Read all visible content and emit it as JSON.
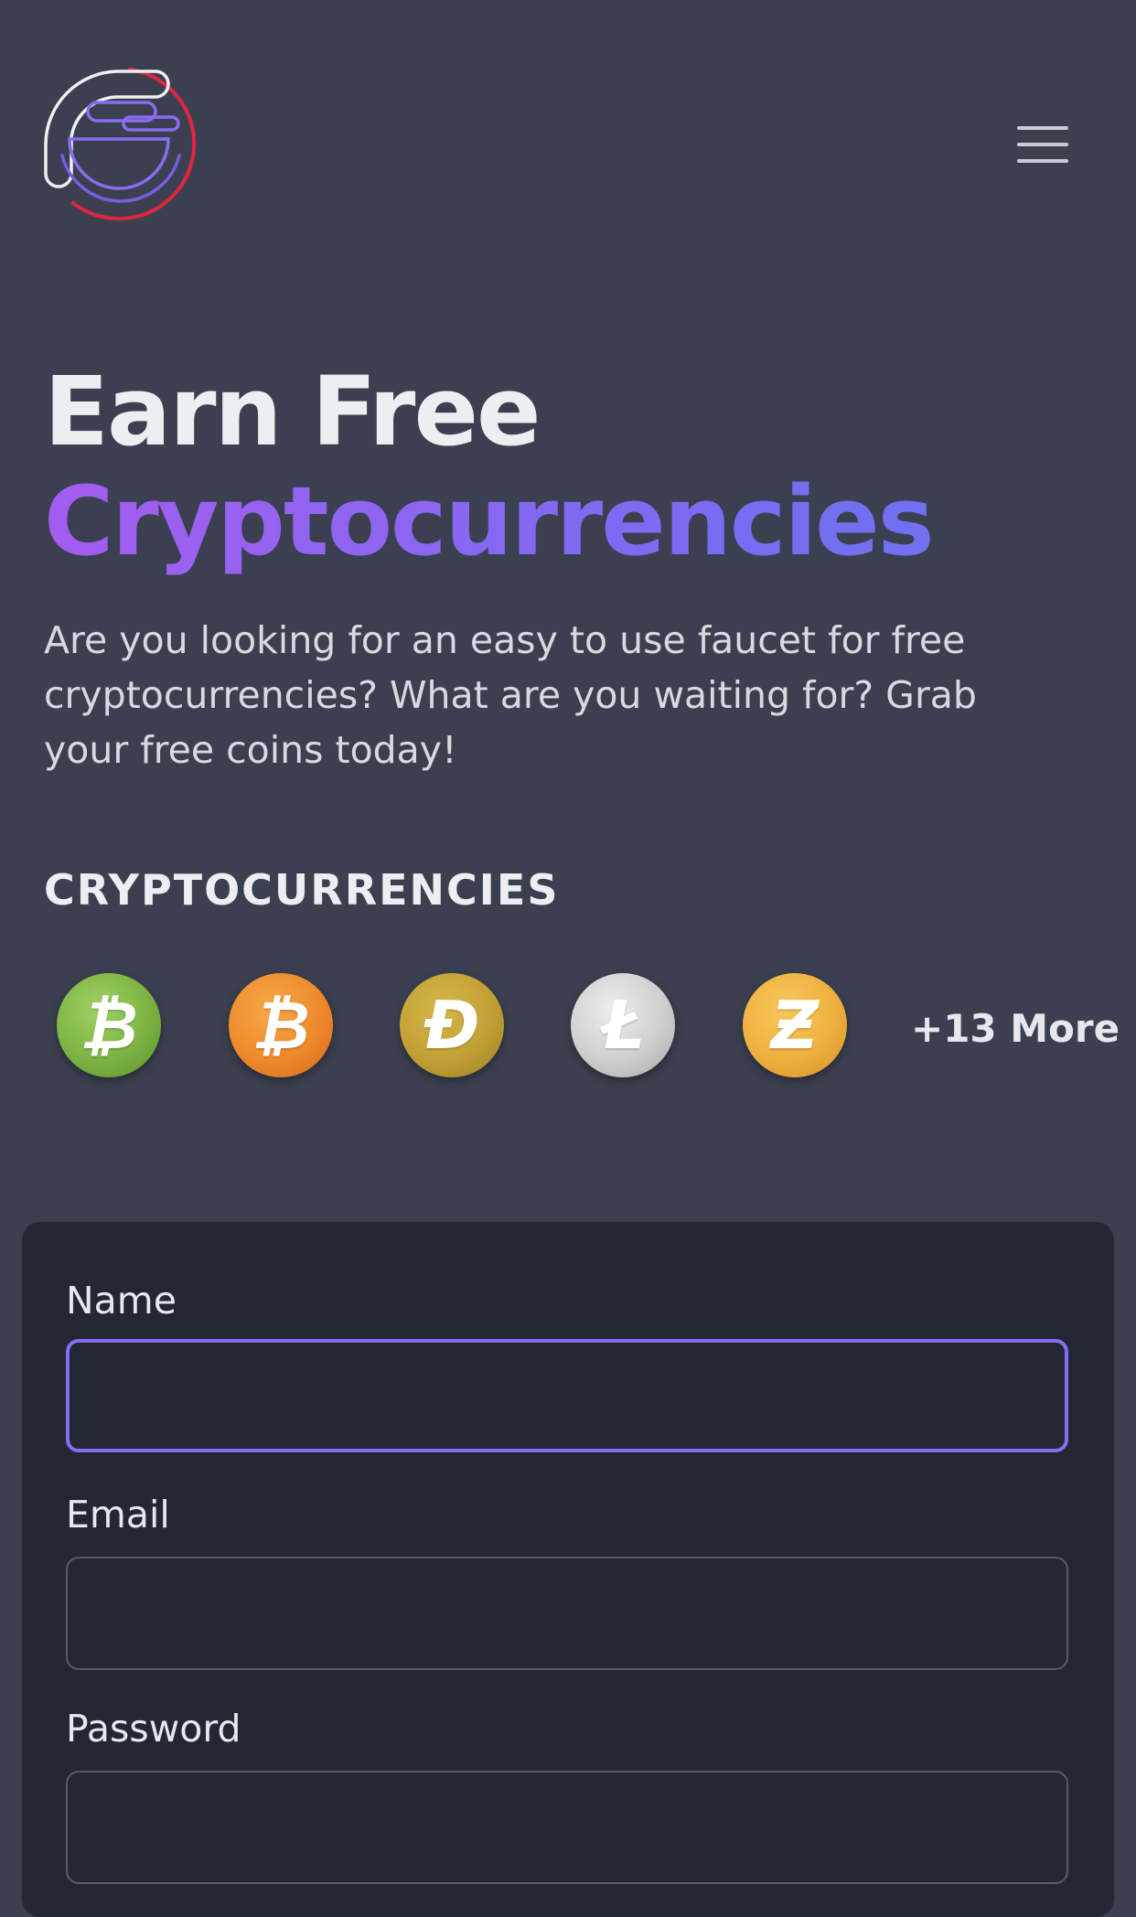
{
  "header": {
    "logo_icon": "faucet-logo-icon",
    "menu_icon": "hamburger-menu-icon"
  },
  "hero": {
    "title_line1": "Earn Free",
    "title_line2": "Cryptocurrencies",
    "description": "Are you looking for an easy to use faucet for free cryptocurrencies? What are you waiting for? Grab your free coins today!"
  },
  "coins_section": {
    "title": "CRYPTOCURRENCIES",
    "coins": [
      {
        "icon": "bitcoin-cash-icon",
        "glyph": "₿",
        "color": "#7cb342"
      },
      {
        "icon": "bitcoin-icon",
        "glyph": "₿",
        "color": "#ee8a2b"
      },
      {
        "icon": "dogecoin-icon",
        "glyph": "Ð",
        "color": "#c2a035"
      },
      {
        "icon": "litecoin-icon",
        "glyph": "Ł",
        "color": "#cfcfcf"
      },
      {
        "icon": "zcash-icon",
        "glyph": "Ƶ",
        "color": "#efb040"
      }
    ],
    "more_label": "+13 More"
  },
  "form": {
    "name_label": "Name",
    "name_value": "",
    "email_label": "Email",
    "email_value": "",
    "password_label": "Password",
    "password_value": ""
  },
  "colors": {
    "background": "#3b4050",
    "card": "#222734",
    "accent": "#8a6cf0",
    "gradient_start": "#a45cf0",
    "gradient_end": "#6b72ef",
    "logo_red": "#e0263f"
  }
}
